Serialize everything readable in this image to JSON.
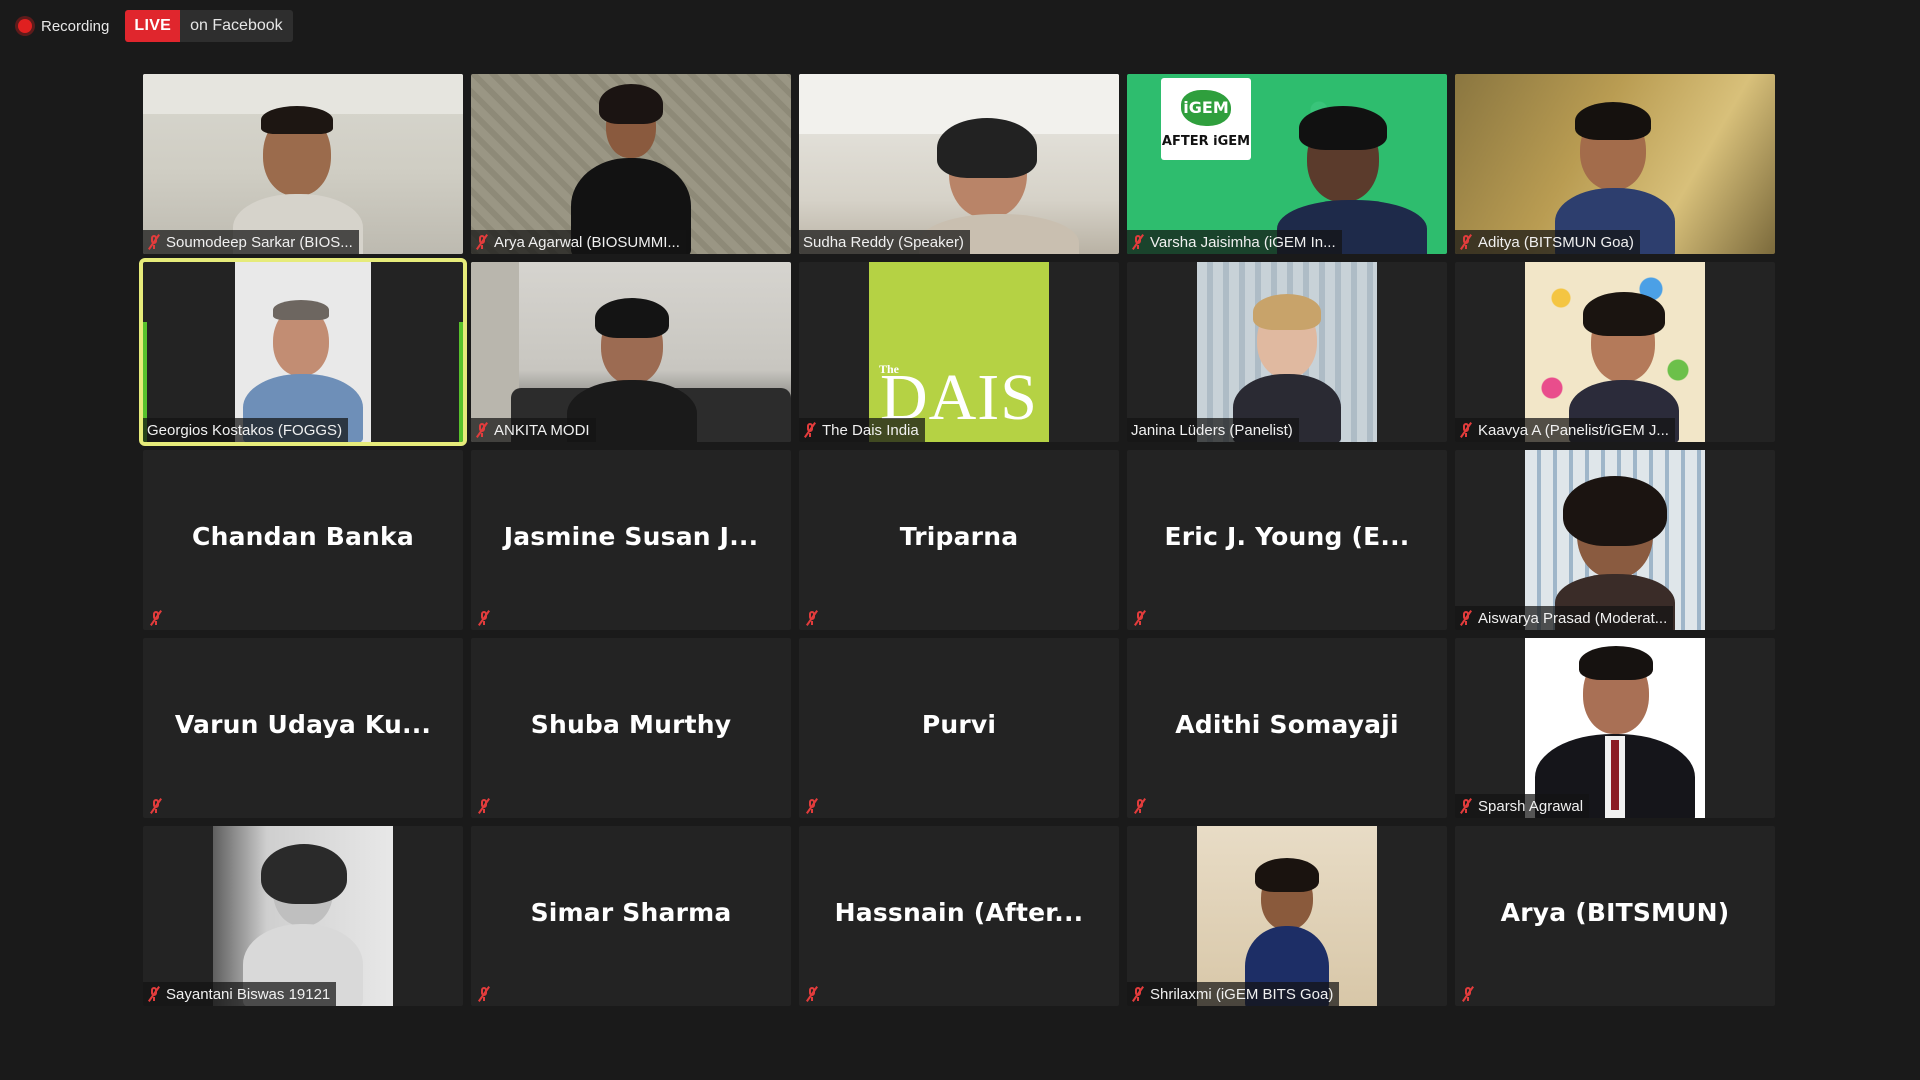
{
  "status_bar": {
    "recording_label": "Recording",
    "live_badge": "LIVE",
    "live_destination": "on Facebook"
  },
  "participants": [
    {
      "name": "Soumodeep Sarkar (BIOS...",
      "video": true,
      "muted": true
    },
    {
      "name": "Arya Agarwal (BIOSUMMI...",
      "video": true,
      "muted": true
    },
    {
      "name": "Sudha Reddy (Speaker)",
      "video": true,
      "muted": false
    },
    {
      "name": "Varsha Jaisimha (iGEM In...",
      "video": true,
      "muted": true
    },
    {
      "name": "Aditya (BITSMUN Goa)",
      "video": true,
      "muted": true
    },
    {
      "name": "Georgios Kostakos (FOGGS)",
      "video": true,
      "muted": false,
      "active_speaker": true
    },
    {
      "name": "ANKITA MODI",
      "video": true,
      "muted": true
    },
    {
      "name": "The Dais India",
      "video": true,
      "muted": true
    },
    {
      "name": "Janina Lüders (Panelist)",
      "video": true,
      "muted": false
    },
    {
      "name": "Kaavya A (Panelist/iGEM J...",
      "video": true,
      "muted": true
    },
    {
      "name": "Chandan Banka",
      "video": false,
      "muted": true
    },
    {
      "name": "Jasmine Susan J...",
      "video": false,
      "muted": true
    },
    {
      "name": "Triparna",
      "video": false,
      "muted": true
    },
    {
      "name": "Eric J. Young (E...",
      "video": false,
      "muted": true
    },
    {
      "name": "Aiswarya Prasad (Moderat...",
      "video": true,
      "muted": true
    },
    {
      "name": "Varun Udaya Ku...",
      "video": false,
      "muted": true
    },
    {
      "name": "Shuba Murthy",
      "video": false,
      "muted": true
    },
    {
      "name": "Purvi",
      "video": false,
      "muted": true
    },
    {
      "name": "Adithi Somayaji",
      "video": false,
      "muted": true
    },
    {
      "name": "Sparsh Agrawal",
      "video": true,
      "muted": true
    },
    {
      "name": "Sayantani Biswas 19121",
      "video": true,
      "muted": true
    },
    {
      "name": "Simar Sharma",
      "video": false,
      "muted": true
    },
    {
      "name": "Hassnain (After...",
      "video": false,
      "muted": true
    },
    {
      "name": "Shrilaxmi (iGEM BITS Goa)",
      "video": true,
      "muted": true
    },
    {
      "name": "Arya (BITSMUN)",
      "video": false,
      "muted": true
    }
  ],
  "branding": {
    "dais_word": "DAIS",
    "dais_the": "The",
    "igem_logo": "iGEM",
    "igem_after": "AFTER iGEM"
  },
  "colors": {
    "background": "#1a1a1a",
    "tile": "#232323",
    "live_red": "#e0262d",
    "mute_red": "#e23c3c",
    "active_speaker_border": "#e6eb7a",
    "dais_green": "#b5d244"
  }
}
